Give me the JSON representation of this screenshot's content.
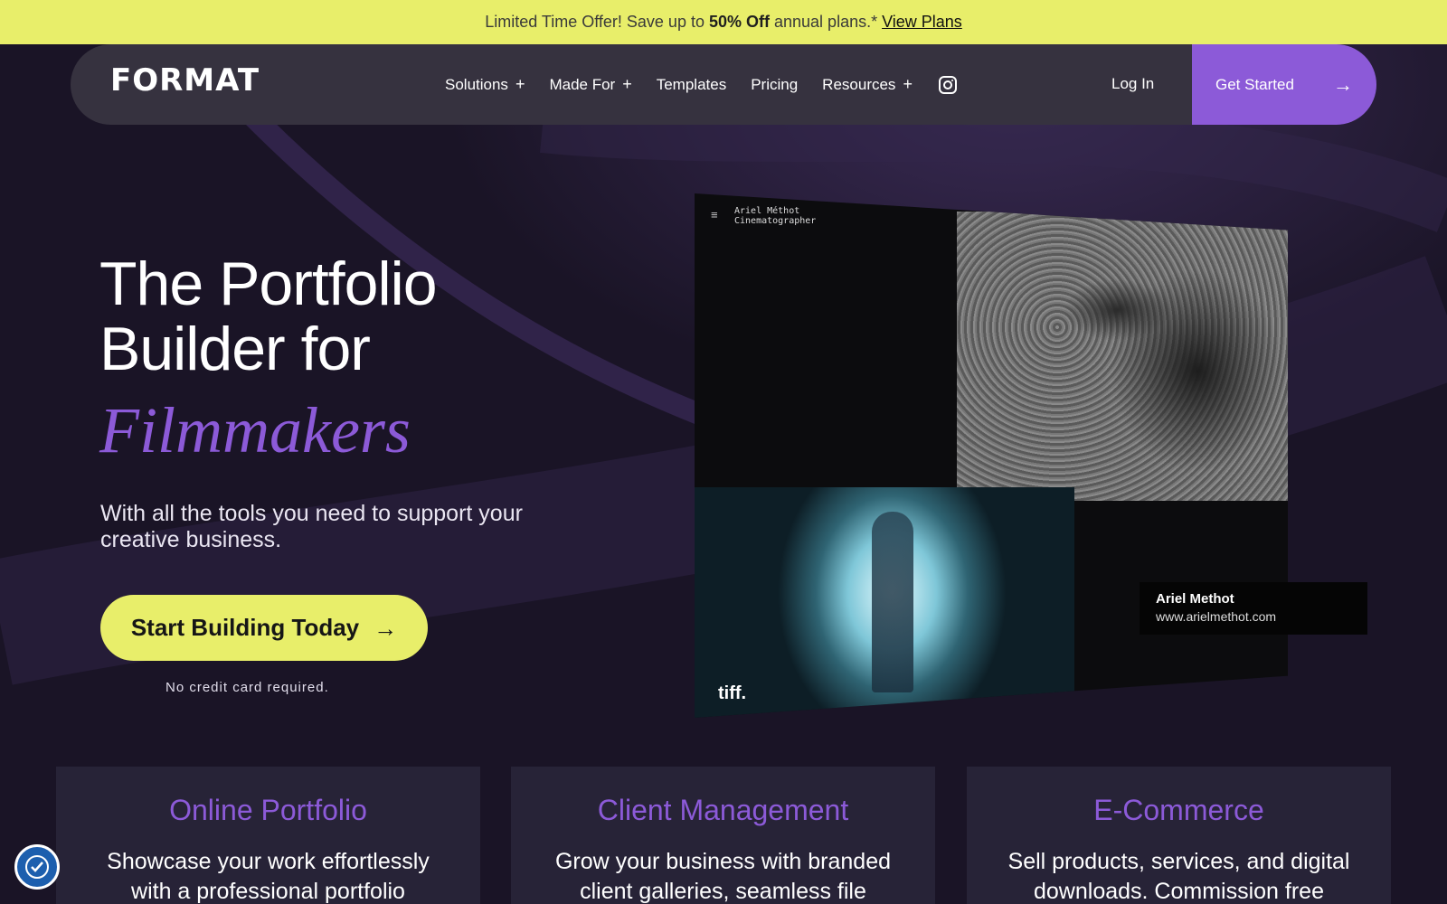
{
  "promo": {
    "text_before": "Limited Time Offer! Save up to",
    "highlight": "50% Off",
    "text_after": "annual plans.*",
    "link": "View Plans"
  },
  "nav": {
    "logo": "FORMAT",
    "items": [
      {
        "label": "Solutions",
        "has_plus": true
      },
      {
        "label": "Made For",
        "has_plus": true
      },
      {
        "label": "Templates",
        "has_plus": false
      },
      {
        "label": "Pricing",
        "has_plus": false
      },
      {
        "label": "Resources",
        "has_plus": true
      }
    ],
    "plus_symbol": "+",
    "login": "Log In",
    "cta": "Get Started",
    "arrow": "→"
  },
  "hero": {
    "title": "The Portfolio Builder for",
    "accent": "Filmmakers",
    "subtitle": "With all the tools you need to support your creative business.",
    "cta": "Start Building Today",
    "arrow": "→",
    "note": "No credit card required."
  },
  "mockup": {
    "menu": "≡",
    "name_line1": "Ariel Méthot",
    "name_line2": "Cinematographer",
    "badge": "tiff.",
    "caption_name": "Ariel Methot",
    "caption_url": "www.arielmethot.com"
  },
  "features": [
    {
      "title": "Online Portfolio",
      "desc": "Showcase your work effortlessly with a professional portfolio"
    },
    {
      "title": "Client Management",
      "desc": "Grow your business with branded client galleries, seamless file"
    },
    {
      "title": "E-Commerce",
      "desc": "Sell products, services, and digital downloads. Commission free"
    }
  ],
  "colors": {
    "accent": "#8c5ad8",
    "yellow": "#e8ee6a",
    "bg": "#1a1426",
    "accessibility": "#1d5fae"
  }
}
